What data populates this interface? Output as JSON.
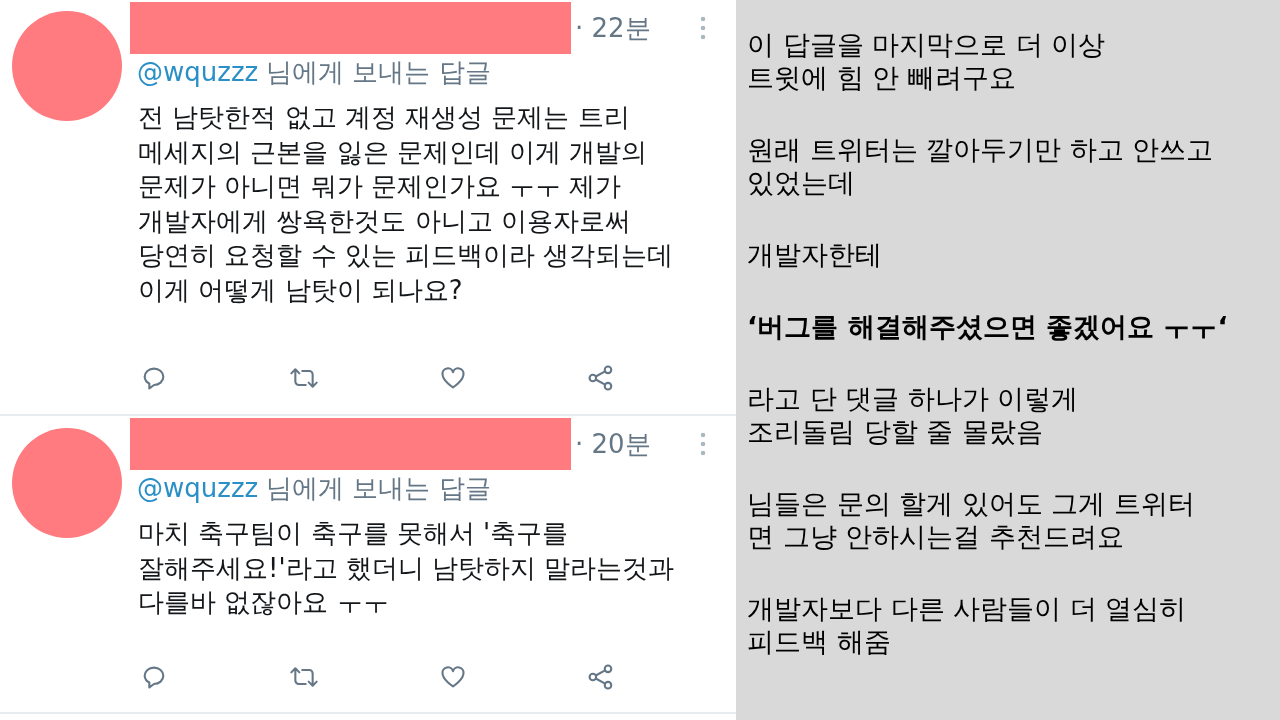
{
  "tweets": [
    {
      "time": "· 22분",
      "reply_to": {
        "handle": "@wquzzz",
        "suffix": "님에게 보내는 답글"
      },
      "body_lines": [
        "전 남탓한적 없고 계정 재생성 문제는 트리",
        "메세지의 근본을 잃은 문제인데 이게 개발의",
        "문제가 아니면 뭐가 문제인가요 ㅜㅜ 제가",
        "개발자에게 쌍욕한것도 아니고 이용자로써",
        "당연히 요청할 수 있는 피드백이라 생각되는데",
        "이게 어떻게 남탓이 되나요?"
      ]
    },
    {
      "time": "· 20분",
      "reply_to": {
        "handle": "@wquzzz",
        "suffix": "님에게 보내는 답글"
      },
      "body_lines": [
        "마치 축구팀이 축구를 못해서 '축구를",
        "잘해주세요!'라고 했더니 남탓하지 말라는것과",
        "다를바 없잖아요 ㅜㅜ"
      ]
    }
  ],
  "note": [
    {
      "kind": "plain",
      "lines": [
        "이 답글을 마지막으로 더 이상",
        "트윗에 힘 안 빼려구요"
      ]
    },
    {
      "kind": "plain",
      "lines": [
        "원래 트위터는 깔아두기만 하고 안쓰고",
        "있었는데"
      ]
    },
    {
      "kind": "plain",
      "lines": [
        "개발자한테"
      ]
    },
    {
      "kind": "bold",
      "lines": [
        "‘버그를 해결해주셨으면 좋겠어요 ㅜㅜ‘"
      ]
    },
    {
      "kind": "plain",
      "lines": [
        "라고 단 댓글 하나가 이렇게",
        "조리돌림 당할 줄 몰랐음"
      ]
    },
    {
      "kind": "plain",
      "lines": [
        "님들은 문의 할게 있어도 그게 트위터",
        "면 그냥 안하시는걸 추천드려요"
      ]
    },
    {
      "kind": "plain",
      "lines": [
        "개발자보다 다른 사람들이 더 열심히",
        "피드백 해줌"
      ]
    }
  ]
}
